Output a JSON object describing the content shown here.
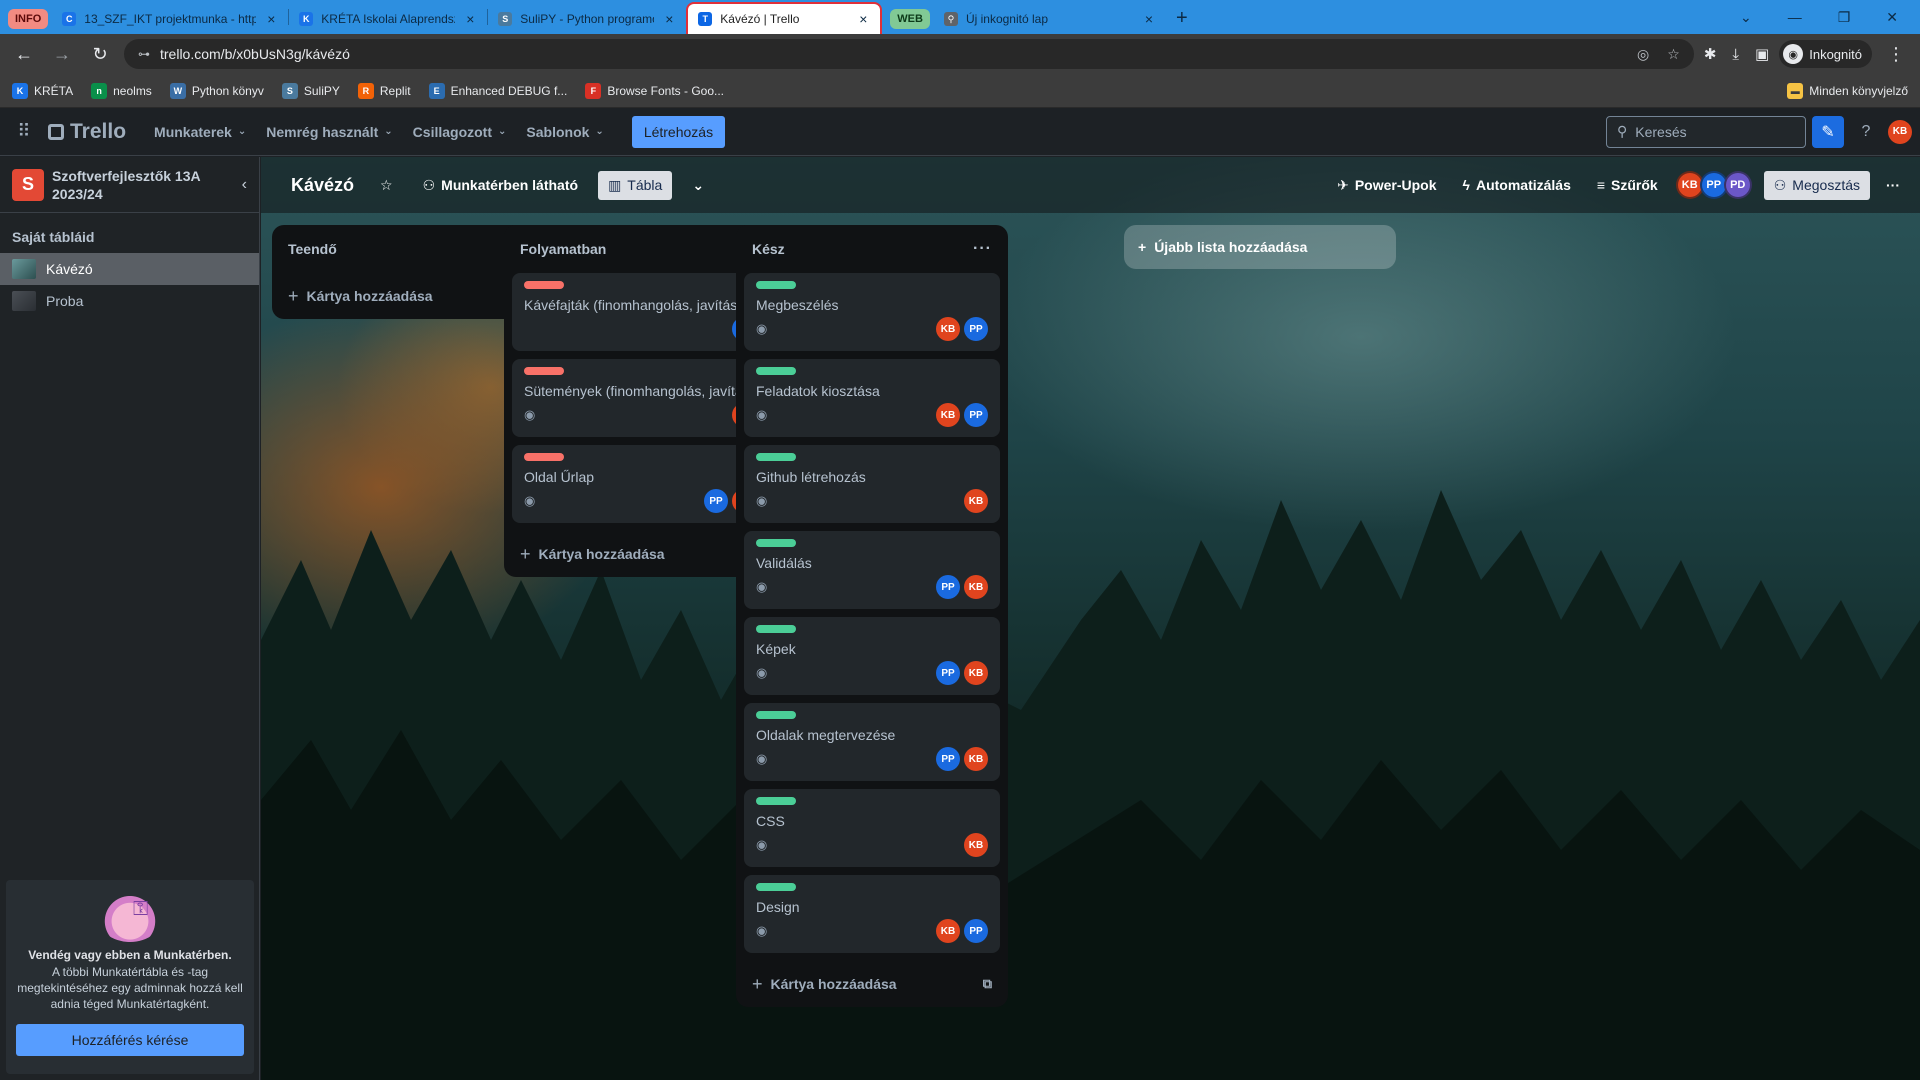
{
  "browser": {
    "tabs": [
      {
        "group": "INFO",
        "group_color": "#f28b82",
        "group_text": "#5c0a0a",
        "title": "13_SZF_IKT projektmunka - http",
        "fav": "C",
        "fav_color": "#1a73e8"
      },
      {
        "title": "KRÉTA Iskolai Alaprendszer",
        "fav": "K",
        "fav_color": "#1a73e8"
      },
      {
        "title": "SuliPY - Python programozás ke",
        "fav": "S",
        "fav_color": "#4a7a9e"
      },
      {
        "title": "Kávézó | Trello",
        "fav": "T",
        "fav_color": "#0c66e4",
        "active": true
      },
      {
        "group": "WEB",
        "group_color": "#81c995",
        "group_text": "#0d3b1a",
        "title": "Új inkognitó lap",
        "fav": "⚲",
        "fav_color": "#5f6368"
      }
    ],
    "url": "trello.com/b/x0bUsN3g/kávézó",
    "incognito_label": "Inkognitó",
    "bookmarks": [
      {
        "label": "KRÉTA",
        "icon": "K",
        "color": "#1a73e8"
      },
      {
        "label": "neolms",
        "icon": "n",
        "color": "#0a8f4a"
      },
      {
        "label": "Python könyv",
        "icon": "W",
        "color": "#3a6ea5"
      },
      {
        "label": "SuliPY",
        "icon": "S",
        "color": "#4a7a9e"
      },
      {
        "label": "Replit",
        "icon": "R",
        "color": "#f26207"
      },
      {
        "label": "Enhanced DEBUG f...",
        "icon": "E",
        "color": "#2b6cb0"
      },
      {
        "label": "Browse Fonts - Goo...",
        "icon": "F",
        "color": "#d93025"
      }
    ],
    "all_bookmarks": "Minden könyvjelző"
  },
  "header": {
    "logo": "Trello",
    "menus": [
      "Munkaterek",
      "Nemrég használt",
      "Csillagozott",
      "Sablonok"
    ],
    "create": "Létrehozás",
    "search_placeholder": "Keresés",
    "user_initials": "KB"
  },
  "sidebar": {
    "workspace_initial": "S",
    "workspace_name": "Szoftverfejlesztők 13A 2023/24",
    "section_title": "Saját tábláid",
    "boards": [
      {
        "name": "Kávézó",
        "selected": true
      },
      {
        "name": "Proba",
        "selected": false
      }
    ],
    "guest": {
      "title": "Vendég vagy ebben a Munkatérben.",
      "text": "A többi Munkatértábla és -tag megtekintéséhez egy adminnak hozzá kell adnia téged Munkatértagként.",
      "button": "Hozzáférés kérése"
    }
  },
  "board": {
    "title": "Kávézó",
    "visibility": "Munkatérben látható",
    "view": "Tábla",
    "power_ups": "Power-Upok",
    "automation": "Automatizálás",
    "filters": "Szűrők",
    "members": [
      "KB",
      "PP",
      "PD"
    ],
    "share": "Megosztás",
    "add_list": "Újabb lista hozzáadása",
    "add_card": "Kártya hozzáadása",
    "lists": [
      {
        "title": "Teendő",
        "cards": []
      },
      {
        "title": "Folyamatban",
        "cards": [
          {
            "title": "Kávéfajták (finomhangolás, javítás)",
            "label": "#f87168",
            "eye": false,
            "members": [
              "PP"
            ]
          },
          {
            "title": "Sütemények (finomhangolás, javítás)",
            "label": "#f87168",
            "eye": true,
            "members": [
              "KB"
            ]
          },
          {
            "title": "Oldal Űrlap",
            "label": "#f87168",
            "eye": true,
            "members": [
              "PP",
              "KB"
            ]
          }
        ]
      },
      {
        "title": "Kész",
        "cards": [
          {
            "title": "Megbeszélés",
            "label": "#4bce97",
            "eye": true,
            "members": [
              "KB",
              "PP"
            ]
          },
          {
            "title": "Feladatok kiosztása",
            "label": "#4bce97",
            "eye": true,
            "members": [
              "KB",
              "PP"
            ]
          },
          {
            "title": "Github létrehozás",
            "label": "#4bce97",
            "eye": true,
            "members": [
              "KB"
            ]
          },
          {
            "title": "Validálás",
            "label": "#4bce97",
            "eye": true,
            "members": [
              "PP",
              "KB"
            ]
          },
          {
            "title": "Képek",
            "label": "#4bce97",
            "eye": true,
            "members": [
              "PP",
              "KB"
            ]
          },
          {
            "title": "Oldalak megtervezése",
            "label": "#4bce97",
            "eye": true,
            "members": [
              "PP",
              "KB"
            ]
          },
          {
            "title": "CSS",
            "label": "#4bce97",
            "eye": true,
            "members": [
              "KB"
            ]
          },
          {
            "title": "Design",
            "label": "#4bce97",
            "eye": true,
            "members": [
              "KB",
              "PP"
            ]
          }
        ]
      }
    ]
  }
}
